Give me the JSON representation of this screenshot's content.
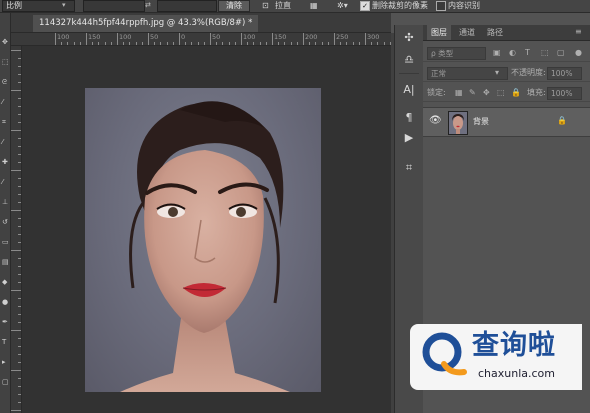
{
  "options_bar": {
    "ratio_value": "比例",
    "clear_button": "清除",
    "straighten_button": "拉直",
    "delete_cropped_label": "删除裁剪的像素",
    "delete_cropped_checked": true,
    "content_aware_label": "内容识别",
    "content_aware_checked": false
  },
  "document_tab": {
    "title": "114327k444h5fpf44rppfh.jpg @ 43.3%(RGB/8#) *"
  },
  "ruler": {
    "labels": [
      "100",
      "150",
      "100",
      "50",
      "0",
      "50",
      "100",
      "150",
      "200",
      "250",
      "300",
      "350"
    ]
  },
  "panel": {
    "tabs": [
      "图层",
      "通道",
      "路径"
    ],
    "active_tab": "图层",
    "filter_label": "ρ 类型",
    "blend_mode": "正常",
    "opacity_label": "不透明度:",
    "opacity_value": "100%",
    "lock_label": "锁定:",
    "fill_label": "填充:",
    "fill_value": "100%",
    "layer": {
      "name": "背景",
      "visible": true,
      "locked": true
    }
  },
  "watermark": {
    "title": "查询啦",
    "subtitle": "chaxunla.com"
  },
  "colors": {
    "accent_blue": "#1f4f98",
    "accent_orange": "#f39a1d",
    "lips": "#c22a35"
  }
}
